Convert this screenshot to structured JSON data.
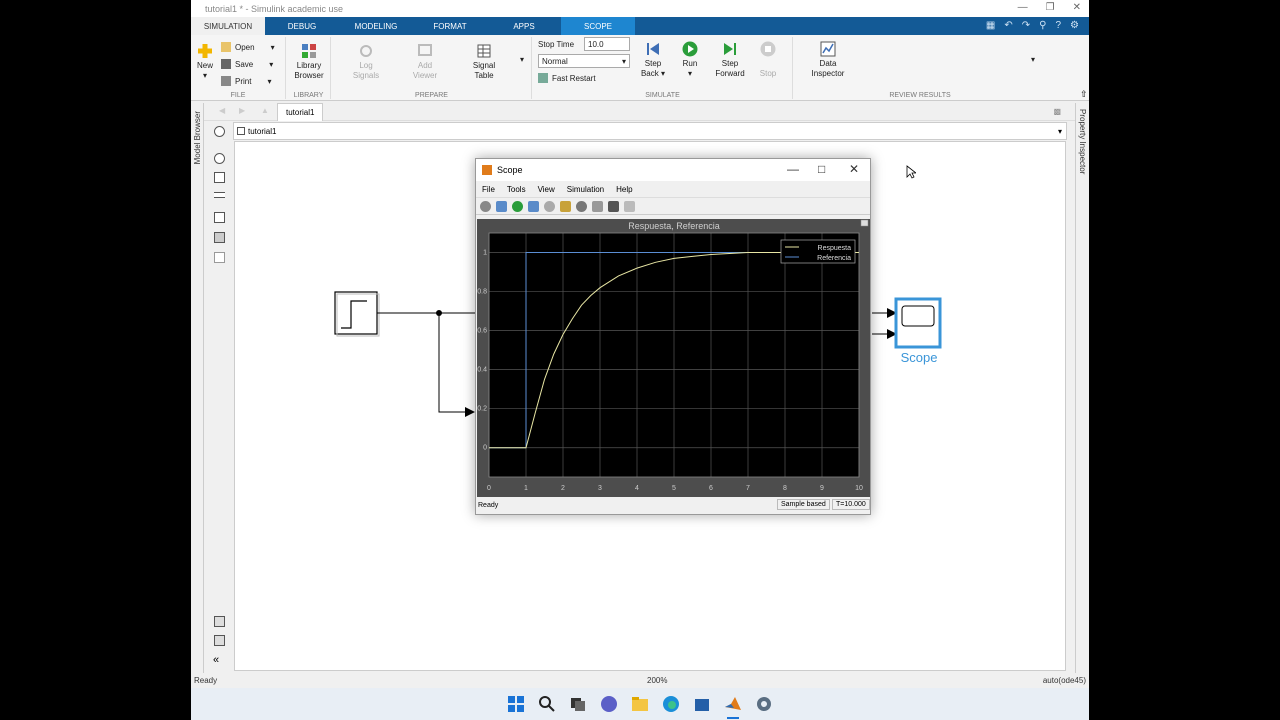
{
  "window": {
    "title": "tutorial1 * - Simulink academic use"
  },
  "ribbon_tabs": [
    "SIMULATION",
    "DEBUG",
    "MODELING",
    "FORMAT",
    "APPS",
    "SCOPE"
  ],
  "ribbon": {
    "file": {
      "new": "New",
      "open": "Open",
      "save": "Save",
      "print": "Print",
      "label": "FILE"
    },
    "library": {
      "browser": [
        "Library",
        "Browser"
      ],
      "label": "LIBRARY"
    },
    "prepare": {
      "log": [
        "Log",
        "Signals"
      ],
      "viewer": [
        "Add",
        "Viewer"
      ],
      "table": [
        "Signal",
        "Table"
      ],
      "label": "PREPARE"
    },
    "simulate": {
      "stop_time_label": "Stop Time",
      "stop_time_value": "10.0",
      "mode": "Normal",
      "fast_restart": "Fast Restart",
      "step_back": [
        "Step",
        "Back"
      ],
      "run": "Run",
      "step_forward": [
        "Step",
        "Forward"
      ],
      "stop": "Stop",
      "label": "SIMULATE"
    },
    "review": {
      "data": [
        "Data",
        "Inspector"
      ],
      "label": "REVIEW RESULTS"
    }
  },
  "nav": {
    "tab": "tutorial1",
    "path": "tutorial1"
  },
  "side_labels": {
    "model_browser": "Model Browser",
    "property_inspector": "Property Inspector"
  },
  "model": {
    "scope_block_label": "Scope"
  },
  "scope_window": {
    "title": "Scope",
    "menu": [
      "File",
      "Tools",
      "View",
      "Simulation",
      "Help"
    ],
    "status": "Ready",
    "sample": "Sample based",
    "time": "T=10.000"
  },
  "chart_data": {
    "type": "line",
    "title": "Respuesta, Referencia",
    "xlabel": "",
    "ylabel": "",
    "xlim": [
      0,
      10
    ],
    "ylim": [
      -0.15,
      1.1
    ],
    "xticks": [
      0,
      1,
      2,
      3,
      4,
      5,
      6,
      7,
      8,
      9,
      10
    ],
    "yticks": [
      0,
      0.2,
      0.4,
      0.6,
      0.8,
      1
    ],
    "grid": true,
    "legend_position": "top-right",
    "series": [
      {
        "name": "Respuesta",
        "color": "#e8e6a4",
        "x": [
          0,
          1,
          1.25,
          1.5,
          1.75,
          2,
          2.25,
          2.5,
          2.75,
          3,
          3.5,
          4,
          4.5,
          5,
          5.5,
          6,
          7,
          8,
          9,
          10
        ],
        "y": [
          0,
          0,
          0.18,
          0.35,
          0.48,
          0.58,
          0.66,
          0.73,
          0.78,
          0.82,
          0.88,
          0.92,
          0.95,
          0.97,
          0.98,
          0.99,
          1,
          1,
          1,
          1
        ]
      },
      {
        "name": "Referencia",
        "color": "#5b8ed4",
        "x": [
          0,
          1,
          1,
          10
        ],
        "y": [
          0,
          0,
          1,
          1
        ]
      }
    ]
  },
  "statusbar": {
    "left": "Ready",
    "zoom": "200%",
    "solver": "auto(ode45)"
  }
}
